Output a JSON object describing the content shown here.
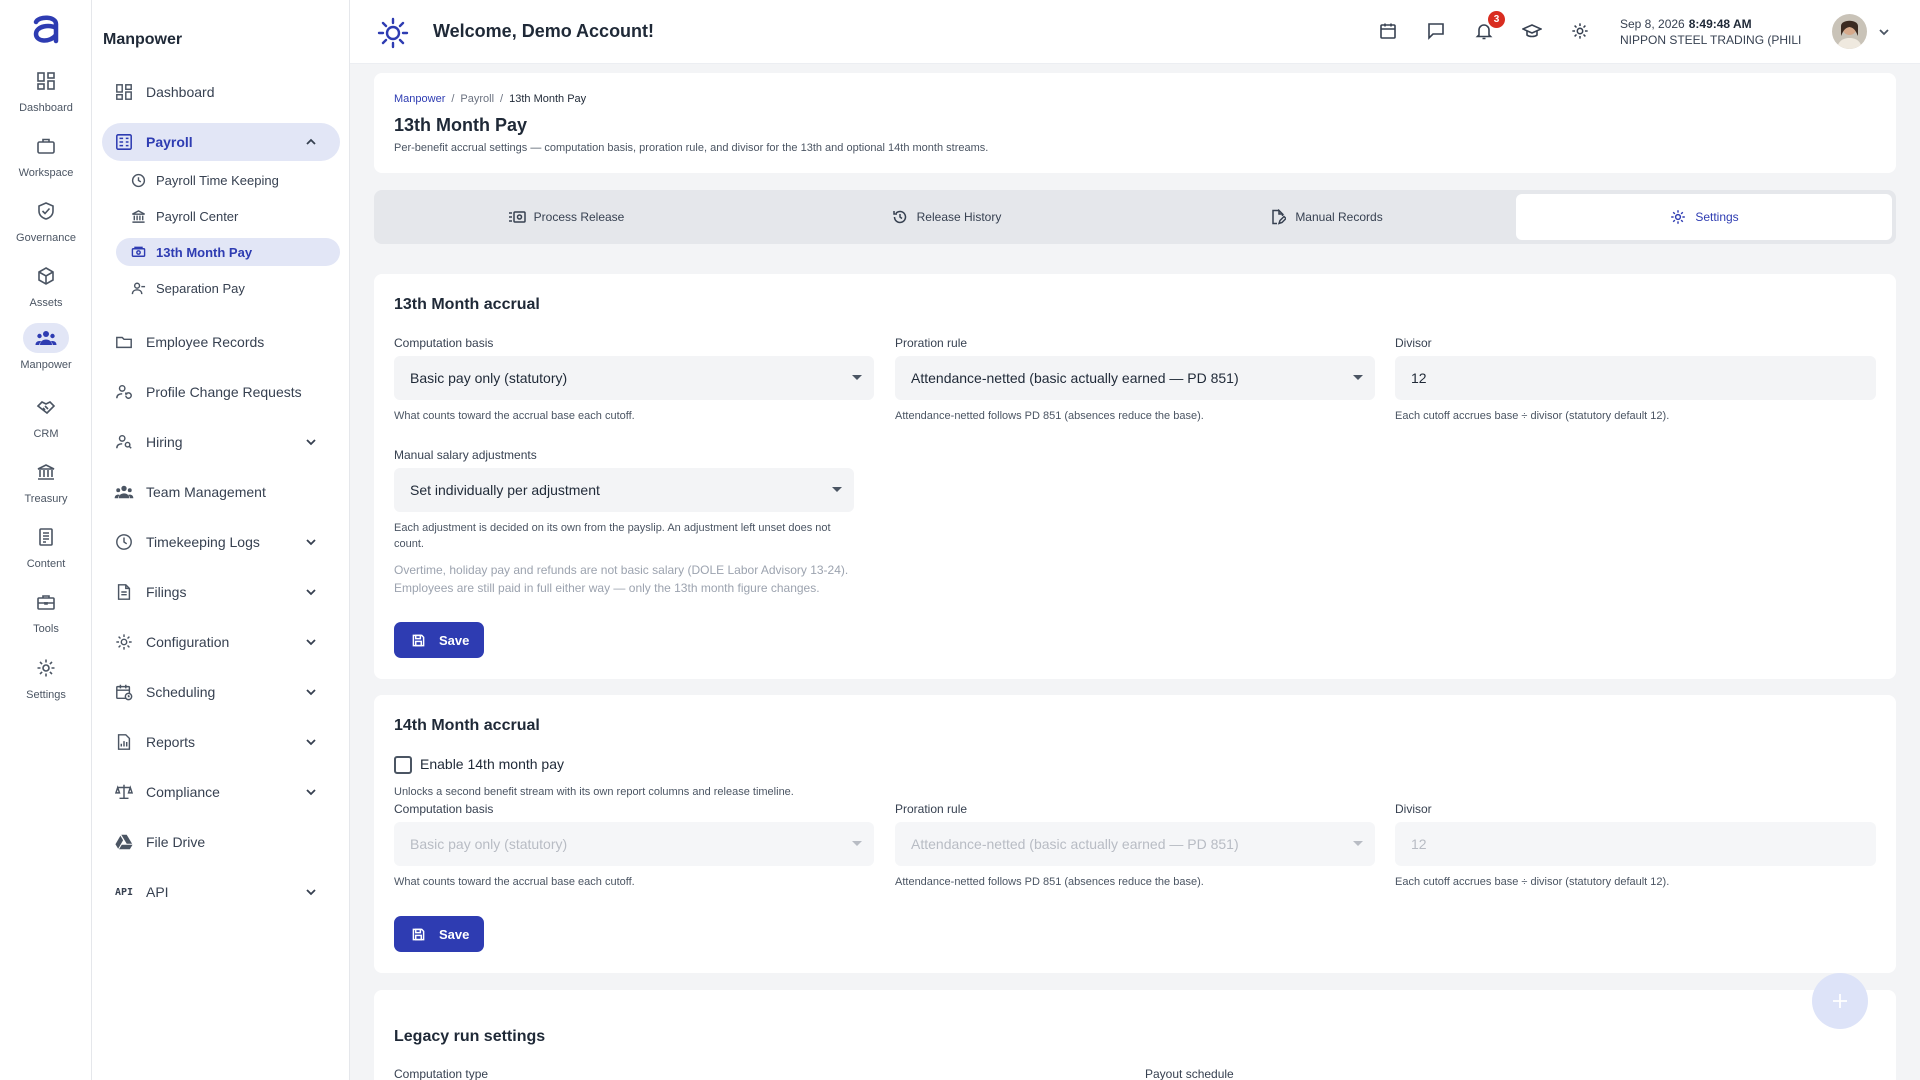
{
  "rail": {
    "items": [
      {
        "label": "Dashboard",
        "icon": "dashboard-icon"
      },
      {
        "label": "Workspace",
        "icon": "briefcase-icon"
      },
      {
        "label": "Governance",
        "icon": "shield-check-icon"
      },
      {
        "label": "Assets",
        "icon": "cube-icon"
      },
      {
        "label": "Manpower",
        "icon": "people-icon"
      },
      {
        "label": "CRM",
        "icon": "handshake-icon"
      },
      {
        "label": "Treasury",
        "icon": "bank-icon"
      },
      {
        "label": "Content",
        "icon": "document-icon"
      },
      {
        "label": "Tools",
        "icon": "toolbox-icon"
      },
      {
        "label": "Settings",
        "icon": "gear-icon"
      }
    ]
  },
  "subnav": {
    "title": "Manpower",
    "items": [
      {
        "label": "Dashboard"
      },
      {
        "label": "Payroll"
      },
      {
        "label": "Employee Records"
      },
      {
        "label": "Profile Change Requests"
      },
      {
        "label": "Hiring"
      },
      {
        "label": "Team Management"
      },
      {
        "label": "Timekeeping Logs"
      },
      {
        "label": "Filings"
      },
      {
        "label": "Configuration"
      },
      {
        "label": "Scheduling"
      },
      {
        "label": "Reports"
      },
      {
        "label": "Compliance"
      },
      {
        "label": "File Drive"
      },
      {
        "label": "API",
        "icon_text": "API"
      }
    ],
    "payroll_children": [
      {
        "label": "Payroll Time Keeping"
      },
      {
        "label": "Payroll Center"
      },
      {
        "label": "13th Month Pay"
      },
      {
        "label": "Separation Pay"
      }
    ]
  },
  "header": {
    "welcome": "Welcome, Demo Account!",
    "notification_count": "3",
    "date": "Sep 8, 2026",
    "time": "8:49:48 AM",
    "company": "NIPPON STEEL TRADING (PHILI..."
  },
  "page": {
    "breadcrumb": {
      "root": "Manpower",
      "middle": "Payroll",
      "current": "13th Month Pay"
    },
    "title": "13th Month Pay",
    "subtitle": "Per-benefit accrual settings — computation basis, proration rule, and divisor for the 13th and optional 14th month streams."
  },
  "tabs": [
    {
      "label": "Process Release"
    },
    {
      "label": "Release History"
    },
    {
      "label": "Manual Records"
    },
    {
      "label": "Settings"
    }
  ],
  "accrual13": {
    "title": "13th Month accrual",
    "basis_label": "Computation basis",
    "basis_value": "Basic pay only (statutory)",
    "basis_help": "What counts toward the accrual base each cutoff.",
    "proration_label": "Proration rule",
    "proration_value": "Attendance-netted (basic actually earned — PD 851)",
    "proration_help": "Attendance-netted follows PD 851 (absences reduce the base).",
    "divisor_label": "Divisor",
    "divisor_value": "12",
    "divisor_help": "Each cutoff accrues base ÷ divisor (statutory default 12).",
    "manual_label": "Manual salary adjustments",
    "manual_value": "Set individually per adjustment",
    "manual_help_1": "Each adjustment is decided on its own from the payslip. An adjustment left unset does not",
    "manual_help_2": "count.",
    "note_1": "Overtime, holiday pay and refunds are not basic salary (DOLE Labor Advisory 13-24).",
    "note_2": "Employees are still paid in full either way — only the 13th month figure changes.",
    "save_label": "Save"
  },
  "accrual14": {
    "title": "14th Month accrual",
    "enable_label": "Enable 14th month pay",
    "enable_help": "Unlocks a second benefit stream with its own report columns and release timeline.",
    "basis_label": "Computation basis",
    "basis_value": "Basic pay only (statutory)",
    "basis_help": "What counts toward the accrual base each cutoff.",
    "proration_label": "Proration rule",
    "proration_value": "Attendance-netted (basic actually earned — PD 851)",
    "proration_help": "Attendance-netted follows PD 851 (absences reduce the base).",
    "divisor_label": "Divisor",
    "divisor_value": "12",
    "divisor_help": "Each cutoff accrues base ÷ divisor (statutory default 12).",
    "save_label": "Save"
  },
  "legacy": {
    "title": "Legacy run settings",
    "computation_type_label": "Computation type",
    "payout_schedule_label": "Payout schedule"
  },
  "colors": {
    "accent": "#2e3cb2",
    "accent_soft": "#e2e6f6",
    "badge": "#d92d20"
  }
}
